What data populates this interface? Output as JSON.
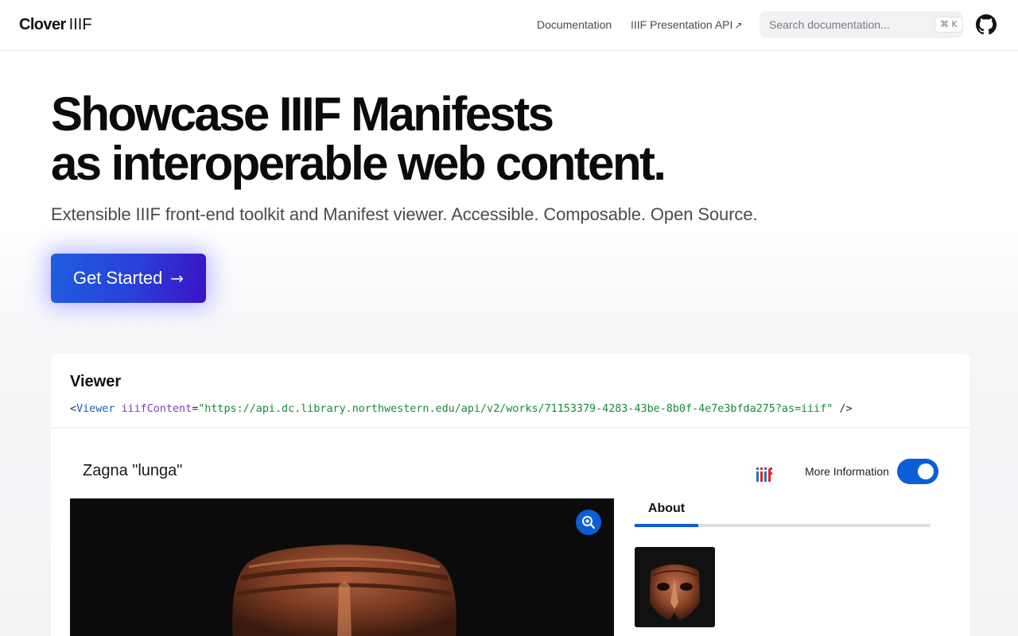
{
  "nav": {
    "logo_main": "Clover",
    "logo_iiif": "IIIF",
    "docs_label": "Documentation",
    "api_label": "IIIF Presentation API",
    "api_ext_icon": "↗",
    "search_placeholder": "Search documentation...",
    "search_shortcut": "⌘ K",
    "github_icon": "github-icon"
  },
  "hero": {
    "title_line1": "Showcase IIIF Manifests",
    "title_line2": "as interoperable web content.",
    "subtitle": "Extensible IIIF front-end toolkit and Manifest viewer. Accessible. Composable. Open Source.",
    "cta_label": "Get Started",
    "cta_arrow": "→"
  },
  "viewer_card": {
    "title": "Viewer",
    "code": {
      "open": "<",
      "tag": "Viewer",
      "attr": "iiifContent",
      "eq": "=",
      "value": "\"https://api.dc.library.northwestern.edu/api/v2/works/71153379-4283-43be-8b0f-4e7e3bfda275?as=iiif\"",
      "close": " />"
    }
  },
  "viewer": {
    "manifest_label": "Zagna \"lunga\"",
    "more_info_label": "More Information",
    "more_info_enabled": true,
    "about_tab": "About"
  },
  "colors": {
    "accent": "#0c5ed6",
    "cta_start": "#1d5fe0",
    "cta_end": "#3a12c6"
  }
}
